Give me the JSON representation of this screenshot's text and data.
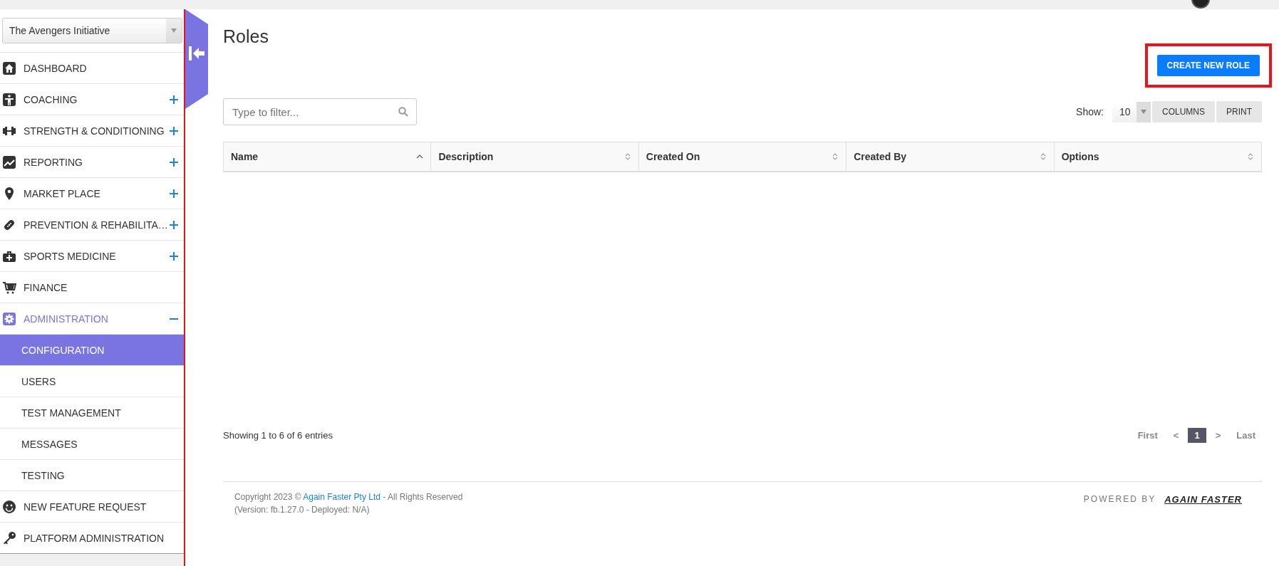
{
  "organisation_select": {
    "value": "The Avengers Initiative"
  },
  "sidebar": {
    "items": [
      {
        "label": "DASHBOARD",
        "selected": false
      },
      {
        "label": "COACHING",
        "expanded": false,
        "selected": false
      },
      {
        "label": "STRENGTH & CONDITIONING",
        "expanded": false,
        "selected": false
      },
      {
        "label": "REPORTING",
        "expanded": false,
        "selected": false
      },
      {
        "label": "MARKET PLACE",
        "expanded": false,
        "selected": false
      },
      {
        "label": "PREVENTION & REHABILITA…",
        "expanded": false,
        "selected": false
      },
      {
        "label": "SPORTS MEDICINE",
        "expanded": false,
        "selected": false
      },
      {
        "label": "FINANCE",
        "selected": false
      },
      {
        "label": "ADMINISTRATION",
        "expanded": true,
        "selected": true,
        "children": [
          {
            "label": "CONFIGURATION",
            "selected": true
          },
          {
            "label": "USERS",
            "selected": false
          },
          {
            "label": "TEST MANAGEMENT",
            "selected": false
          },
          {
            "label": "MESSAGES",
            "selected": false
          },
          {
            "label": "TESTING",
            "selected": false
          }
        ]
      },
      {
        "label": "NEW FEATURE REQUEST",
        "selected": false
      },
      {
        "label": "PLATFORM ADMINISTRATION",
        "selected": false
      }
    ]
  },
  "page": {
    "title": "Roles",
    "create_button": {
      "label": "CREATE NEW ROLE",
      "highlighted": true
    },
    "filter": {
      "placeholder": "Type to filter..."
    },
    "show": {
      "label": "Show:",
      "value": "10"
    },
    "toolbar_buttons": [
      "COLUMNS",
      "PRINT"
    ]
  },
  "table": {
    "columns": [
      {
        "label": "Name",
        "sorted": true
      },
      {
        "label": "Description",
        "sorted": false
      },
      {
        "label": "Created On",
        "sorted": false
      },
      {
        "label": "Created By",
        "sorted": false
      },
      {
        "label": "Options",
        "sorted": false
      }
    ]
  },
  "table_info": "Showing 1 to 6 of 6 entries",
  "pagination": {
    "first": "First",
    "previous": "<",
    "pages": [
      {
        "label": "1",
        "selected": true
      }
    ],
    "next": ">",
    "last": "Last"
  },
  "footer": {
    "copyright_before": "Copyright 2023 ©",
    "company_link": "Again Faster Pty Ltd",
    "copyright_after": "- All Rights Reserved",
    "version": "(Version: fb.1.27.0 - Deployed: N/A)",
    "powered_by": "POWERED BY",
    "brand": "AGAIN FASTER"
  }
}
